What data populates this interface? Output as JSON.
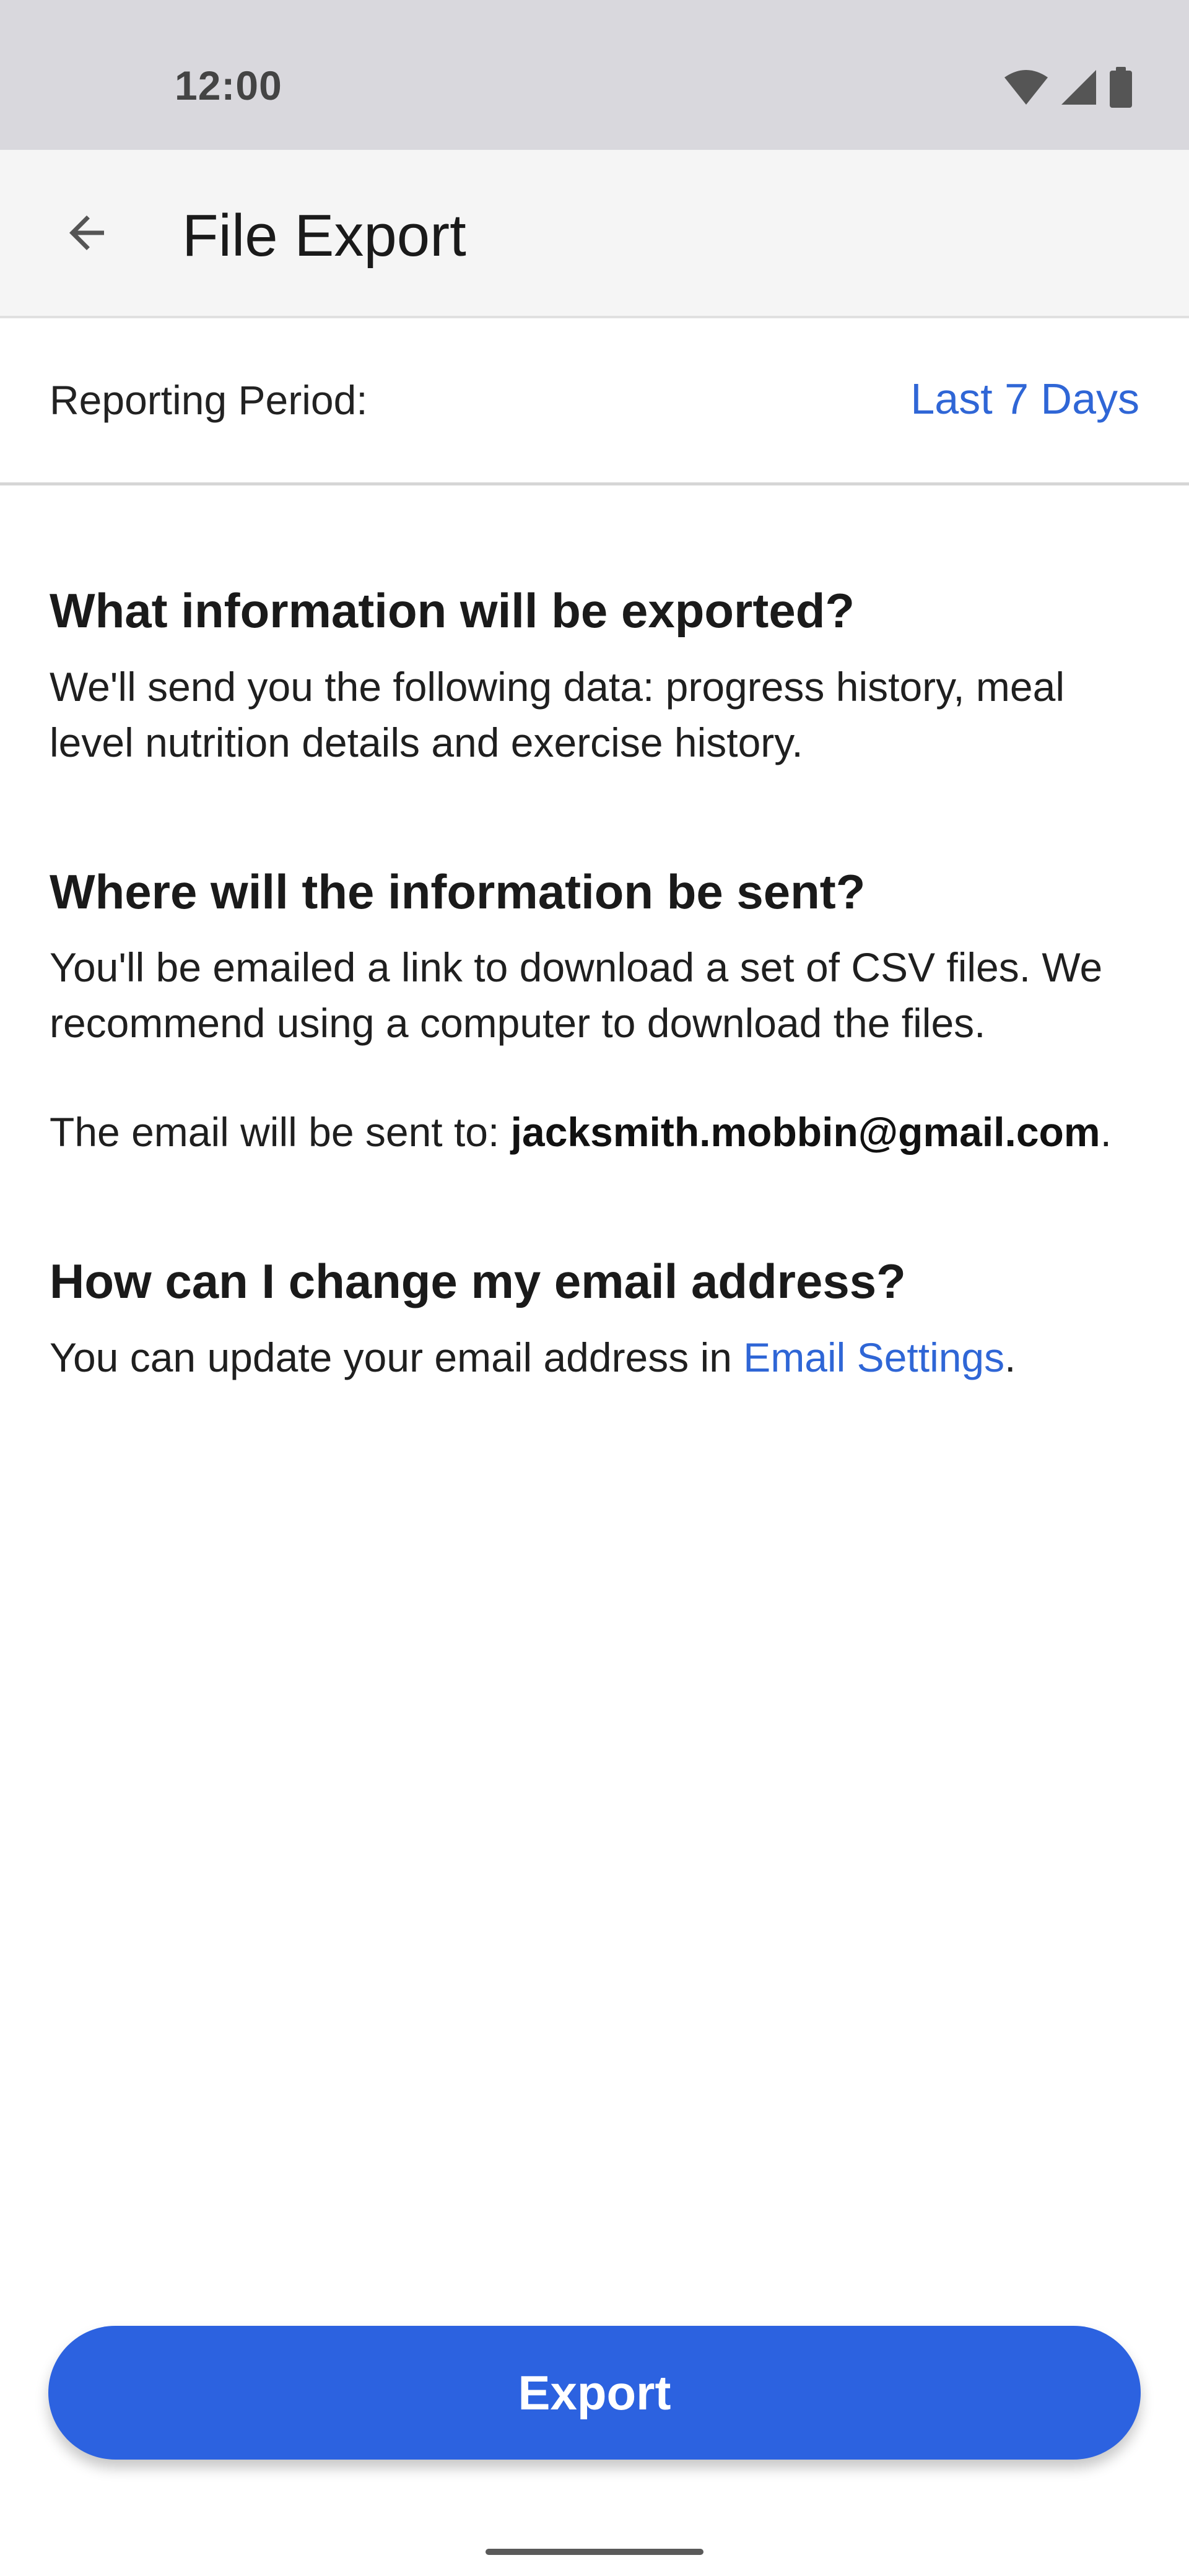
{
  "status_bar": {
    "time": "12:00",
    "icons": [
      "wifi-icon",
      "signal-icon",
      "battery-icon"
    ]
  },
  "app_bar": {
    "back_icon": "arrow-back-icon",
    "title": "File Export"
  },
  "reporting_period": {
    "label": "Reporting Period:",
    "value": "Last 7 Days"
  },
  "sections": {
    "what": {
      "heading": "What information will be exported?",
      "body": "We'll send you the following data: progress history, meal level nutrition details and exercise history."
    },
    "where": {
      "heading": "Where will the information be sent?",
      "body": "You'll be emailed a link to download a set of CSV files. We recommend using a computer to download the files.",
      "email_prefix": "The email will be sent to: ",
      "email": "jacksmith.mobbin@gmail.com",
      "email_suffix": "."
    },
    "change": {
      "heading": "How can I change my email address?",
      "body_prefix": "You can update your email address in ",
      "link": "Email Settings",
      "body_suffix": "."
    }
  },
  "export_button": {
    "label": "Export"
  },
  "colors": {
    "accent": "#2c62e0",
    "link": "#2f66d6",
    "status_bar_bg": "#d9d8dd",
    "app_bar_bg": "#f5f5f5"
  }
}
